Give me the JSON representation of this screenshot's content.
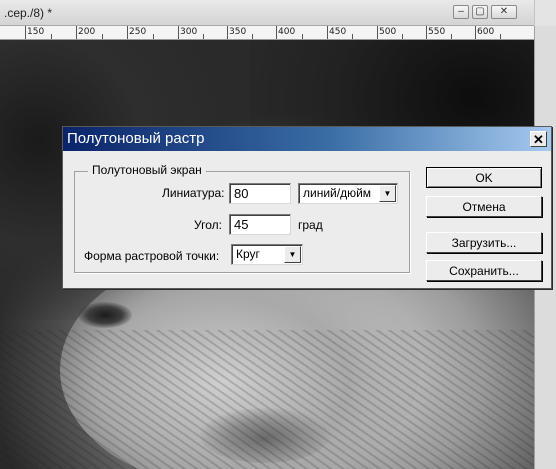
{
  "document": {
    "title": ".сер./8) *",
    "ruler_labels": [
      "150",
      "200",
      "250",
      "300",
      "350",
      "400",
      "450",
      "500",
      "550",
      "600"
    ],
    "controls": {
      "minimize": "–",
      "restore": "▢",
      "close": "✕"
    }
  },
  "dialog": {
    "title": "Полутоновый растр",
    "close_glyph": "✕",
    "group_label": "Полутоновый экран",
    "lpi": {
      "label": "Линиатура:",
      "value": "80",
      "unit": "линий/дюйм"
    },
    "angle": {
      "label": "Угол:",
      "value": "45",
      "unit": "град"
    },
    "shape": {
      "label": "Форма растровой точки:",
      "value": "Круг"
    },
    "buttons": {
      "ok": "OK",
      "cancel": "Отмена",
      "load": "Загрузить...",
      "save": "Сохранить..."
    },
    "dropdown_arrow": "▼"
  }
}
